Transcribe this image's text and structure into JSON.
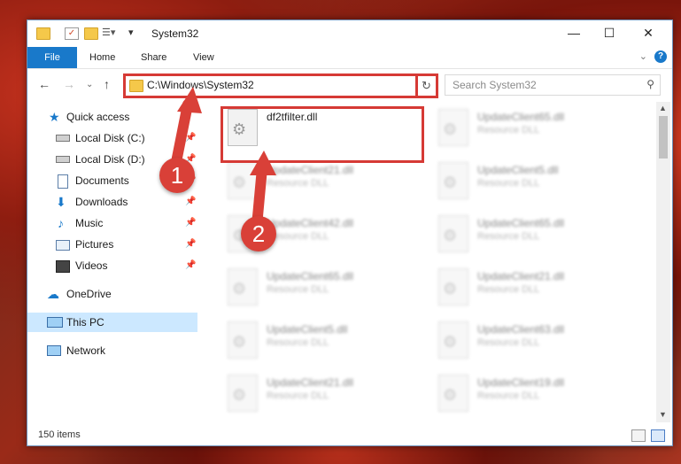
{
  "window": {
    "title": "System32",
    "controls": {
      "minimize": "—",
      "maximize": "☐",
      "close": "✕"
    }
  },
  "ribbon": {
    "file_tab": "File",
    "tabs": [
      "Home",
      "Share",
      "View"
    ],
    "help_label": "?"
  },
  "address_bar": {
    "path": "C:\\Windows\\System32",
    "dropdown_symbol": "⌄",
    "refresh_symbol": "↻"
  },
  "search": {
    "placeholder": "Search System32"
  },
  "sidebar": {
    "items": [
      {
        "label": "Quick access",
        "icon": "star-icon",
        "pinned": false
      },
      {
        "label": "Local Disk (C:)",
        "icon": "drive-icon",
        "pinned": true
      },
      {
        "label": "Local Disk (D:)",
        "icon": "drive-icon",
        "pinned": true
      },
      {
        "label": "Documents",
        "icon": "documents-icon",
        "pinned": true
      },
      {
        "label": "Downloads",
        "icon": "download-icon",
        "pinned": true
      },
      {
        "label": "Music",
        "icon": "music-icon",
        "pinned": true
      },
      {
        "label": "Pictures",
        "icon": "pictures-icon",
        "pinned": true
      },
      {
        "label": "Videos",
        "icon": "videos-icon",
        "pinned": true
      },
      {
        "label": "OneDrive",
        "icon": "cloud-icon",
        "pinned": false
      },
      {
        "label": "This PC",
        "icon": "computer-icon",
        "pinned": false,
        "selected": true
      },
      {
        "label": "Network",
        "icon": "network-icon",
        "pinned": false
      }
    ]
  },
  "files": [
    {
      "name": "df2tfilter.dll",
      "type": "",
      "highlighted": true
    },
    {
      "name": "UpdateClient65.dll",
      "type": "Resource DLL"
    },
    {
      "name": "UpdateClient21.dll",
      "type": "Resource DLL"
    },
    {
      "name": "UpdateClient5.dll",
      "type": "Resource DLL"
    },
    {
      "name": "UpdateClient42.dll",
      "type": "Resource DLL"
    },
    {
      "name": "UpdateClient65.dll",
      "type": "Resource DLL"
    },
    {
      "name": "UpdateClient65.dll",
      "type": "Resource DLL"
    },
    {
      "name": "UpdateClient21.dll",
      "type": "Resource DLL"
    },
    {
      "name": "UpdateClient5.dll",
      "type": "Resource DLL"
    },
    {
      "name": "UpdateClient63.dll",
      "type": "Resource DLL"
    },
    {
      "name": "UpdateClient21.dll",
      "type": "Resource DLL"
    },
    {
      "name": "UpdateClient19.dll",
      "type": "Resource DLL"
    }
  ],
  "status": {
    "item_count": "150 items"
  },
  "annotations": {
    "step1": "1",
    "step2": "2",
    "color": "#d94038"
  }
}
